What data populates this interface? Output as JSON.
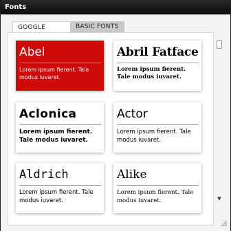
{
  "window": {
    "title": "Fonts"
  },
  "tabs": [
    {
      "label": "GOOGLE FONTS",
      "active": true
    },
    {
      "label": "BASIC FONTS",
      "active": false
    }
  ],
  "fonts": [
    {
      "name": "Abel",
      "sample": "Lorem ipsum fierent. Tale modus iuvaret.",
      "selected": true
    },
    {
      "name": "Abril Fatface",
      "sample": "Lorem ipsum fierent. Tale modus iuvaret.",
      "selected": false
    },
    {
      "name": "Aclonica",
      "sample": "Lorem ipsum fierent. Tale modus iuvaret.",
      "selected": false
    },
    {
      "name": "Actor",
      "sample": "Lorem ipsum fierent. Tale modus iuvaret.",
      "selected": false
    },
    {
      "name": "Aldrich",
      "sample": "Lorem ipsum fierent. Tale modus iuvaret.",
      "selected": false
    },
    {
      "name": "Alike",
      "sample": "Lorem ipsum fierent. Tale modus iuvaret.",
      "selected": false
    }
  ],
  "colors": {
    "selected_card": "#cf0a0a",
    "titlebar": "#111111"
  },
  "icons": {
    "scroll_up": "scroll-up-arrow-icon",
    "scroll_down": "scroll-down-arrow-icon",
    "resize": "resize-grip-icon"
  }
}
